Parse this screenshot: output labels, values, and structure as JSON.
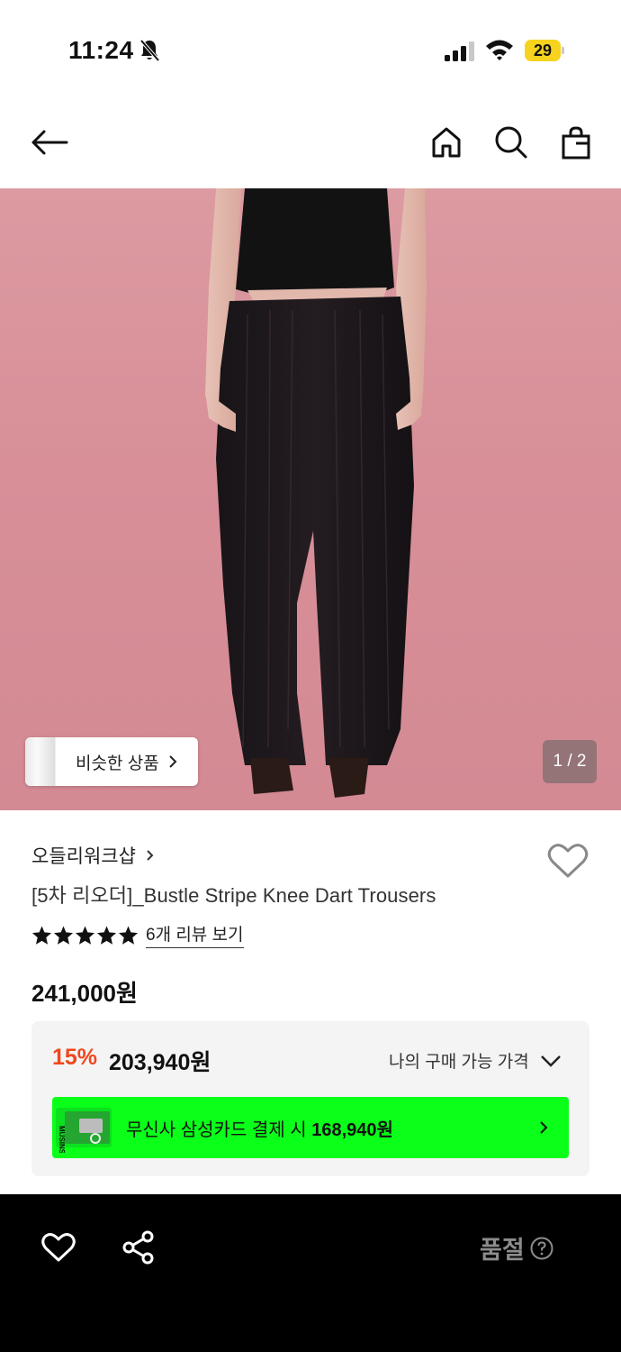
{
  "status_bar": {
    "time": "11:24",
    "battery": "29"
  },
  "hero": {
    "similar_label": "비슷한 상품",
    "counter": "1 / 2"
  },
  "product": {
    "brand": "오들리워크샵",
    "title": "[5차 리오더]_Bustle Stripe Knee Dart Trousers",
    "rating_stars": 5,
    "review_link": "6개 리뷰 보기",
    "original_price": "241,000원"
  },
  "price_box": {
    "discount_rate": "15%",
    "discount_price": "203,940원",
    "my_price_label": "나의 구매 가능 가격",
    "card_text": "무신사 삼성카드 결제 시 ",
    "card_price": "168,940원",
    "card_image_text": "MUSINSA"
  },
  "bottom_bar": {
    "soldout_label": "품절"
  },
  "colors": {
    "accent_discount": "#f0471d",
    "card_banner": "#0aff19",
    "hero_background": "#dc9aa1",
    "bottom_bar": "#000000"
  },
  "icons": [
    "back-arrow-icon",
    "home-icon",
    "search-icon",
    "shopping-bag-icon",
    "heart-icon",
    "share-icon",
    "help-icon",
    "bell-slash-icon",
    "signal-icon",
    "wifi-icon"
  ]
}
